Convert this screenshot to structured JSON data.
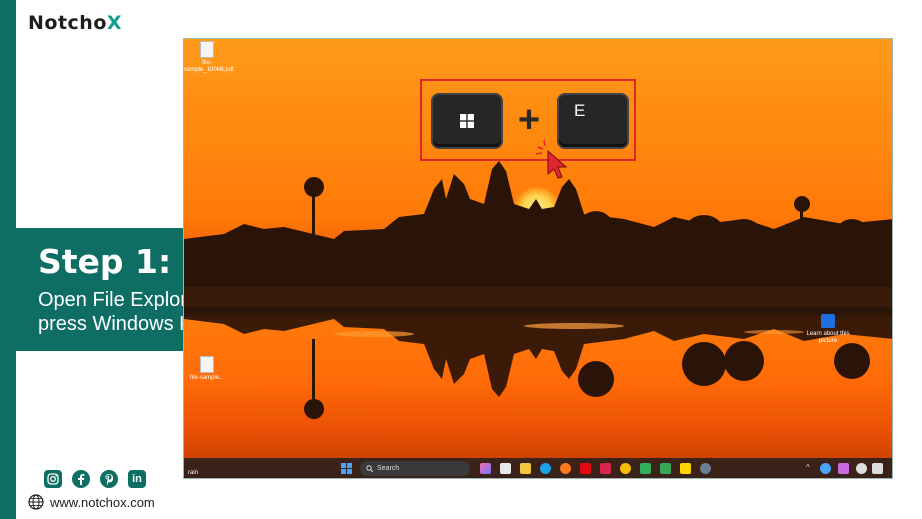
{
  "brand": {
    "name_prefix": "Notcho",
    "name_suffix": "X",
    "accent": "#0f6e64"
  },
  "step": {
    "title": "Step 1:",
    "line1": "Open File Explorer,",
    "line2": "press Windows Key + E"
  },
  "footer": {
    "website": "www.notchox.com",
    "social": [
      "instagram-icon",
      "facebook-icon",
      "pinterest-icon",
      "linkedin-icon"
    ],
    "linkedin_label": "in"
  },
  "desktop": {
    "icons": [
      {
        "label": "file-sample_100kB.pdf",
        "label_short": "file-sample..."
      },
      {
        "label": "file-sample...",
        "label_short": "file-sample..."
      }
    ],
    "shortcut": {
      "key1": "windows",
      "plus": "+",
      "key2": "E"
    },
    "learn_picture": "Learn about this picture",
    "weather_text": "rain",
    "taskbar": {
      "search_placeholder": "Search"
    }
  }
}
